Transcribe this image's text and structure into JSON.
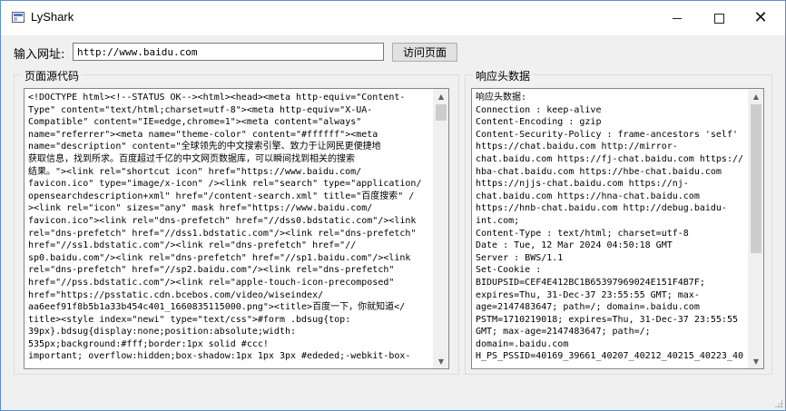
{
  "window": {
    "title": "LyShark",
    "icon": "app-window-icon",
    "controls": {
      "minimize": "minimize-icon",
      "maximize": "maximize-icon",
      "close": "close-icon"
    }
  },
  "toolbar": {
    "url_label": "输入网址:",
    "url_value": "http://www.baidu.com",
    "go_label": "访问页面"
  },
  "source_panel": {
    "title": "页面源代码",
    "lines": [
      "<!DOCTYPE html><!--STATUS OK--><html><head><meta http-equiv=\"Content-",
      "Type\" content=\"text/html;charset=utf-8\"><meta http-equiv=\"X-UA-",
      "Compatible\" content=\"IE=edge,chrome=1\"><meta content=\"always\"",
      "name=\"referrer\"><meta name=\"theme-color\" content=\"#ffffff\"><meta",
      "name=\"description\" content=\"全球领先的中文搜索引擎、致力于让网民更便捷地",
      "获取信息，找到所求。百度超过千亿的中文网页数据库，可以瞬间找到相关的搜索",
      "结果。\"><link rel=\"shortcut icon\" href=\"https://www.baidu.com/",
      "favicon.ico\" type=\"image/x-icon\" /><link rel=\"search\" type=\"application/",
      "opensearchdescription+xml\" href=\"/content-search.xml\" title=\"百度搜索\" /",
      "><link rel=\"icon\" sizes=\"any\" mask href=\"https://www.baidu.com/",
      "favicon.ico\"><link rel=\"dns-prefetch\" href=\"//dss0.bdstatic.com\"/><link",
      "rel=\"dns-prefetch\" href=\"//dss1.bdstatic.com\"/><link rel=\"dns-prefetch\"",
      "href=\"//ss1.bdstatic.com\"/><link rel=\"dns-prefetch\" href=\"//",
      "sp0.baidu.com\"/><link rel=\"dns-prefetch\" href=\"//sp1.baidu.com\"/><link",
      "rel=\"dns-prefetch\" href=\"//sp2.baidu.com\"/><link rel=\"dns-prefetch\"",
      "href=\"//pss.bdstatic.com\"/><link rel=\"apple-touch-icon-precomposed\"",
      "href=\"https://psstatic.cdn.bcebos.com/video/wiseindex/",
      "aa6eef91f8b5b1a33b454c401_1660835115000.png\"><title>百度一下，你就知道</",
      "title><style index=\"newi\" type=\"text/css\">#form .bdsug{top:",
      "39px}.bdsug{display:none;position:absolute;width:",
      "535px;background:#fff;border:1px solid #ccc!",
      "important; overflow:hidden;box-shadow:1px 1px 3px #ededed;-webkit-box-"
    ]
  },
  "headers_panel": {
    "title": "响应头数据",
    "lines": [
      "响应头数据:",
      "Connection : keep-alive",
      "Content-Encoding : gzip",
      "Content-Security-Policy : frame-ancestors 'self'",
      "https://chat.baidu.com http://mirror-",
      "chat.baidu.com https://fj-chat.baidu.com https://",
      "hba-chat.baidu.com https://hbe-chat.baidu.com",
      "https://njjs-chat.baidu.com https://nj-",
      "chat.baidu.com https://hna-chat.baidu.com",
      "https://hnb-chat.baidu.com http://debug.baidu-",
      "int.com;",
      "Content-Type : text/html; charset=utf-8",
      "Date : Tue, 12 Mar 2024 04:50:18 GMT",
      "Server : BWS/1.1",
      "Set-Cookie :",
      "BIDUPSID=CEF4E412BC1B65397969024E151F4B7F;",
      "expires=Thu, 31-Dec-37 23:55:55 GMT; max-",
      "age=2147483647; path=/; domain=.baidu.com",
      "PSTM=1710219018; expires=Thu, 31-Dec-37 23:55:55",
      "GMT; max-age=2147483647; path=/;",
      "domain=.baidu.com",
      "H_PS_PSSID=40169_39661_40207_40212_40215_40223_40"
    ]
  },
  "scrollbar": {
    "up_icon": "▲",
    "down_icon": "▼"
  }
}
